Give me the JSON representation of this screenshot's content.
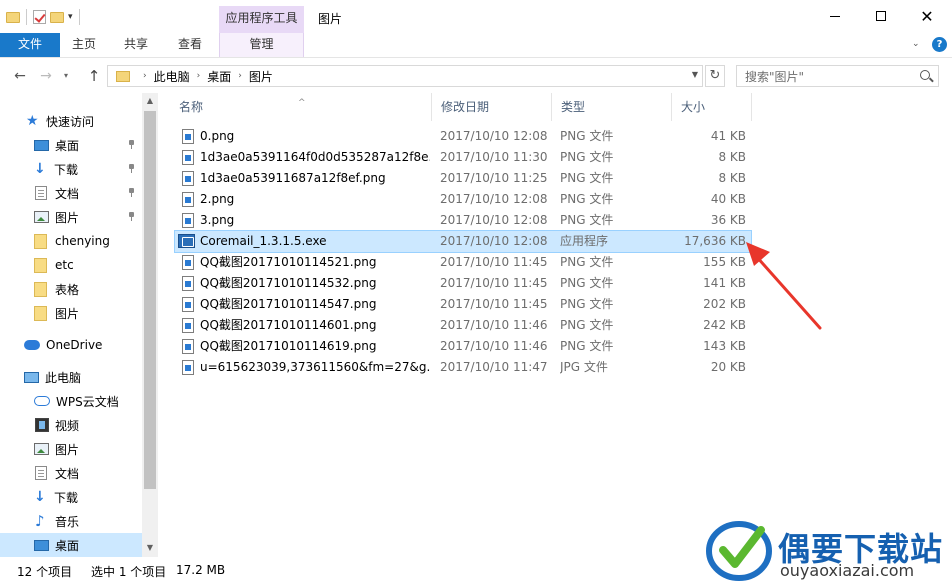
{
  "window": {
    "title": "图片",
    "context_tab_header": "应用程序工具",
    "close_glyph": "✕"
  },
  "ribbon": {
    "tabs": [
      "文件",
      "主页",
      "共享",
      "查看",
      "管理"
    ]
  },
  "address": {
    "crumbs": [
      "此电脑",
      "桌面",
      "图片"
    ],
    "search_placeholder": "搜索\"图片\""
  },
  "nav": {
    "items": [
      {
        "label": "快速访问",
        "icon": "star-icon"
      },
      {
        "label": "桌面",
        "icon": "desktop-icon",
        "pinned": true
      },
      {
        "label": "下载",
        "icon": "download-icon",
        "pinned": true
      },
      {
        "label": "文档",
        "icon": "document-icon",
        "pinned": true
      },
      {
        "label": "图片",
        "icon": "picture-icon",
        "pinned": true
      },
      {
        "label": "chenying",
        "icon": "folder-icon"
      },
      {
        "label": "etc",
        "icon": "folder-icon"
      },
      {
        "label": "表格",
        "icon": "folder-icon"
      },
      {
        "label": "图片",
        "icon": "folder-icon"
      },
      {
        "label": "OneDrive",
        "icon": "cloud-icon"
      },
      {
        "label": "此电脑",
        "icon": "computer-icon"
      },
      {
        "label": "WPS云文档",
        "icon": "wps-cloud-icon"
      },
      {
        "label": "视频",
        "icon": "video-icon"
      },
      {
        "label": "图片",
        "icon": "picture-icon"
      },
      {
        "label": "文档",
        "icon": "document-icon"
      },
      {
        "label": "下载",
        "icon": "download-icon"
      },
      {
        "label": "音乐",
        "icon": "music-icon"
      },
      {
        "label": "桌面",
        "icon": "desktop-icon",
        "selected": true
      }
    ]
  },
  "columns": {
    "name": "名称",
    "date": "修改日期",
    "type": "类型",
    "size": "大小"
  },
  "files": [
    {
      "name": "0.png",
      "date": "2017/10/10 12:08",
      "type": "PNG 文件",
      "size": "41 KB",
      "kind": "png"
    },
    {
      "name": "1d3ae0a5391164f0d0d535287a12f8e...",
      "date": "2017/10/10 11:30",
      "type": "PNG 文件",
      "size": "8 KB",
      "kind": "png"
    },
    {
      "name": "1d3ae0a53911687a12f8ef.png",
      "date": "2017/10/10 11:25",
      "type": "PNG 文件",
      "size": "8 KB",
      "kind": "png"
    },
    {
      "name": "2.png",
      "date": "2017/10/10 12:08",
      "type": "PNG 文件",
      "size": "40 KB",
      "kind": "png"
    },
    {
      "name": "3.png",
      "date": "2017/10/10 12:08",
      "type": "PNG 文件",
      "size": "36 KB",
      "kind": "png"
    },
    {
      "name": "Coremail_1.3.1.5.exe",
      "date": "2017/10/10 12:08",
      "type": "应用程序",
      "size": "17,636 KB",
      "kind": "exe",
      "selected": true
    },
    {
      "name": "QQ截图20171010114521.png",
      "date": "2017/10/10 11:45",
      "type": "PNG 文件",
      "size": "155 KB",
      "kind": "png"
    },
    {
      "name": "QQ截图20171010114532.png",
      "date": "2017/10/10 11:45",
      "type": "PNG 文件",
      "size": "141 KB",
      "kind": "png"
    },
    {
      "name": "QQ截图20171010114547.png",
      "date": "2017/10/10 11:45",
      "type": "PNG 文件",
      "size": "202 KB",
      "kind": "png"
    },
    {
      "name": "QQ截图20171010114601.png",
      "date": "2017/10/10 11:46",
      "type": "PNG 文件",
      "size": "242 KB",
      "kind": "png"
    },
    {
      "name": "QQ截图20171010114619.png",
      "date": "2017/10/10 11:46",
      "type": "PNG 文件",
      "size": "143 KB",
      "kind": "png"
    },
    {
      "name": "u=615623039,373611560&fm=27&g...",
      "date": "2017/10/10 11:47",
      "type": "JPG 文件",
      "size": "20 KB",
      "kind": "jpg"
    }
  ],
  "status": {
    "count": "12 个项目",
    "selection": "选中 1 个项目",
    "size": "17.2 MB"
  },
  "watermark": {
    "title": "偶要下载站",
    "url": "ouyaoxiazai.com"
  },
  "colors": {
    "accent": "#1979ca",
    "selection": "#cce8ff",
    "context_tab": "#e8d9f6",
    "annotation_arrow": "#e8362b"
  }
}
